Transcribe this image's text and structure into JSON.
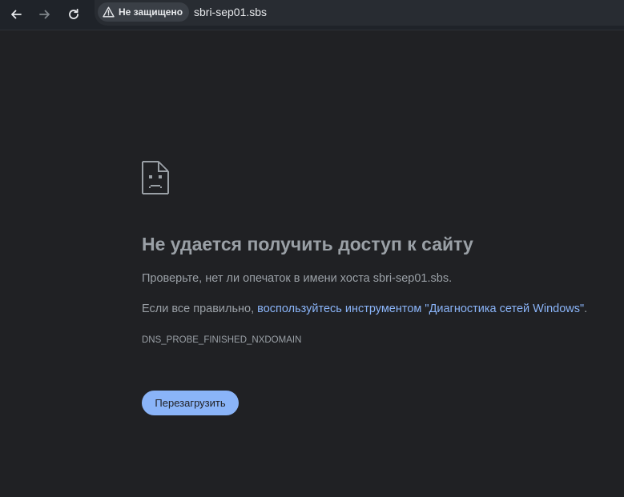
{
  "browser": {
    "security_label": "Не защищено",
    "url": "sbri-sep01.sbs",
    "icons": {
      "back": "arrow-left-icon",
      "forward": "arrow-right-icon",
      "reload": "reload-icon",
      "security": "warning-triangle-icon"
    }
  },
  "error_page": {
    "icon": "sad-page-icon",
    "title": "Не удается получить доступ к сайту",
    "check_text": "Проверьте, нет ли опечаток в имени хоста sbri-sep01.sbs.",
    "if_correct_prefix": "Если все правильно, ",
    "diagnostics_link": "воспользуйтесь инструментом \"Диагностика сетей Windows\"",
    "if_correct_suffix": ".",
    "error_code": "DNS_PROBE_FINISHED_NXDOMAIN",
    "reload_button_label": "Перезагрузить"
  },
  "colors": {
    "page_background": "#202124",
    "toolbar_background": "#1f2329",
    "text_secondary": "#9aa0a6",
    "link": "#8ab4f8",
    "button_background": "#8ab4f8"
  }
}
